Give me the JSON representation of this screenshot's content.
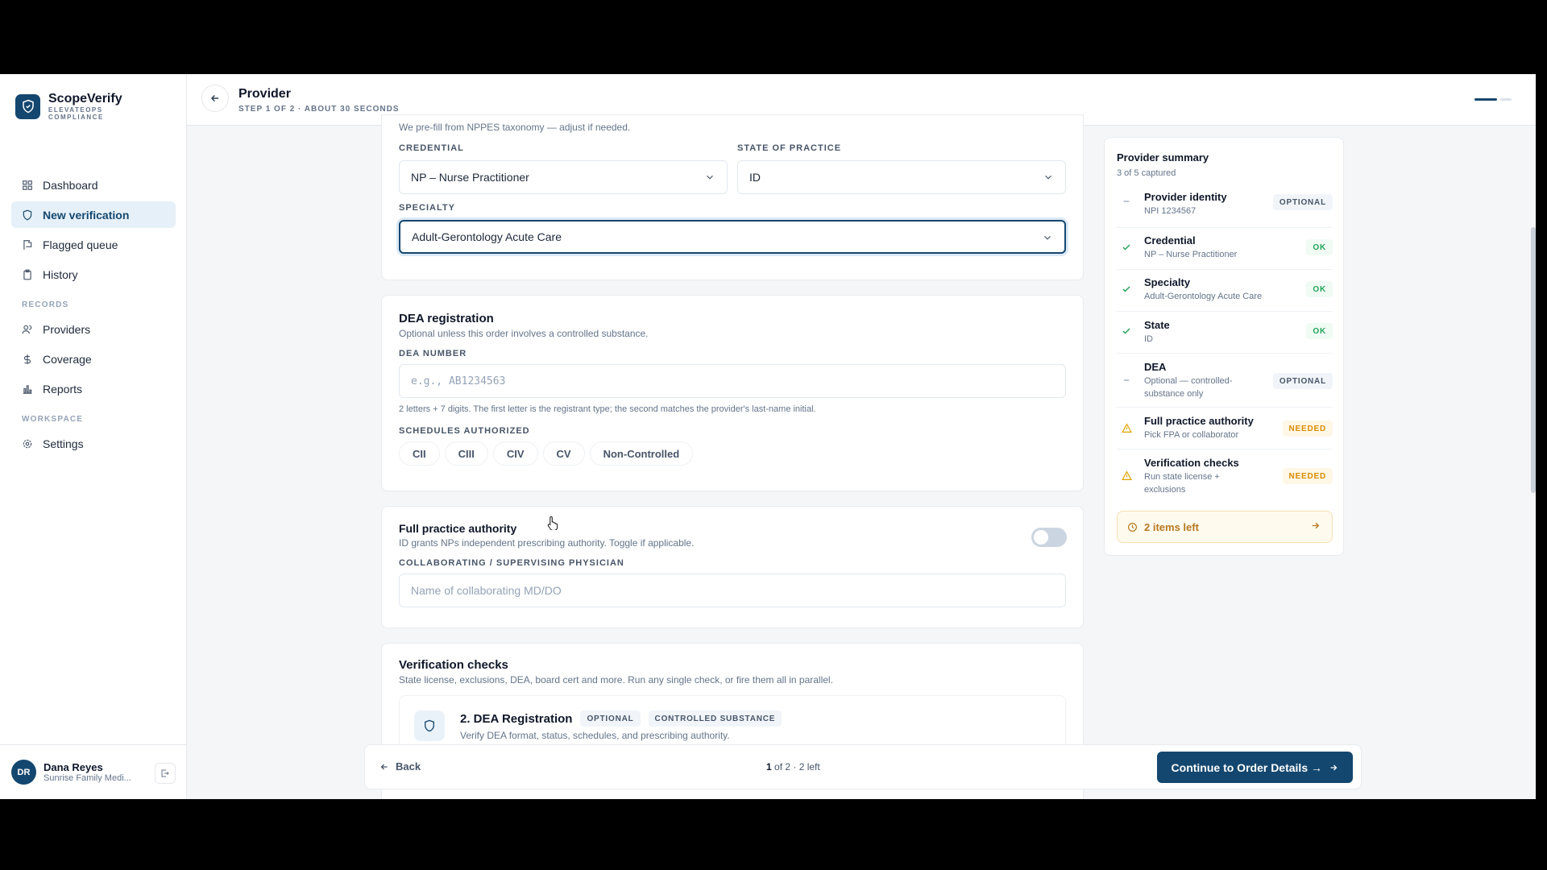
{
  "brand": {
    "name": "ScopeVerify",
    "sub1": "ELEVATEOPS",
    "sub2": "COMPLIANCE"
  },
  "nav": {
    "dashboard": "Dashboard",
    "new_verification": "New verification",
    "flagged_queue": "Flagged queue",
    "history": "History",
    "records_label": "RECORDS",
    "providers": "Providers",
    "coverage": "Coverage",
    "reports": "Reports",
    "workspace_label": "WORKSPACE",
    "settings": "Settings"
  },
  "user": {
    "initials": "DR",
    "name": "Dana Reyes",
    "org": "Sunrise Family Medi..."
  },
  "header": {
    "title": "Provider",
    "step": "STEP 1 OF 2 · ABOUT 30 SECONDS",
    "progress_current": 1,
    "progress_total": 2
  },
  "credential_card": {
    "hint": "We pre-fill from NPPES taxonomy — adjust if needed.",
    "credential_label": "CREDENTIAL",
    "credential_value": "NP – Nurse Practitioner",
    "state_label": "STATE OF PRACTICE",
    "state_value": "ID",
    "specialty_label": "SPECIALTY",
    "specialty_value": "Adult-Gerontology Acute Care"
  },
  "dea_card": {
    "title": "DEA registration",
    "subtitle": "Optional unless this order involves a controlled substance.",
    "number_label": "DEA NUMBER",
    "number_placeholder": "e.g., AB1234563",
    "help": "2 letters + 7 digits. The first letter is the registrant type; the second matches the provider's last-name initial.",
    "schedules_label": "SCHEDULES AUTHORIZED",
    "schedules": [
      "CII",
      "CIII",
      "CIV",
      "CV",
      "Non-Controlled"
    ]
  },
  "fpa_card": {
    "title": "Full practice authority",
    "subtitle": "ID grants NPs independent prescribing authority. Toggle if applicable.",
    "toggle_on": false,
    "physician_label": "COLLABORATING / SUPERVISING PHYSICIAN",
    "physician_placeholder": "Name of collaborating MD/DO"
  },
  "checks_card": {
    "title": "Verification checks",
    "subtitle": "State license, exclusions, DEA, board cert and more. Run any single check, or fire them all in parallel.",
    "item_title": "2. DEA Registration",
    "item_tag1": "OPTIONAL",
    "item_tag2": "CONTROLLED SUBSTANCE",
    "item_desc": "Verify DEA format, status, schedules, and prescribing authority."
  },
  "summary": {
    "title": "Provider summary",
    "subtitle": "3 of 5 captured",
    "rows": [
      {
        "name": "Provider identity",
        "value": "NPI 1234567",
        "status": "OPTIONAL",
        "kind": "opt"
      },
      {
        "name": "Credential",
        "value": "NP – Nurse Practitioner",
        "status": "OK",
        "kind": "ok"
      },
      {
        "name": "Specialty",
        "value": "Adult-Gerontology Acute Care",
        "status": "OK",
        "kind": "ok"
      },
      {
        "name": "State",
        "value": "ID",
        "status": "OK",
        "kind": "ok"
      },
      {
        "name": "DEA",
        "value": "Optional — controlled-",
        "value2": "substance only",
        "status": "OPTIONAL",
        "kind": "opt"
      },
      {
        "name": "Full practice authority",
        "value": "Pick FPA or collaborator",
        "status": "NEEDED",
        "kind": "need"
      },
      {
        "name": "Verification checks",
        "value": "Run state license +",
        "value2": "exclusions",
        "status": "NEEDED",
        "kind": "need"
      }
    ],
    "items_left": "2 items left"
  },
  "footer": {
    "back": "Back",
    "page_current": "1",
    "page_rest": " of 2 · 2 left",
    "cta": "Continue to Order Details →"
  },
  "colors": {
    "brand": "#14476f",
    "ok": "#22a35a",
    "needed": "#d98b00"
  }
}
